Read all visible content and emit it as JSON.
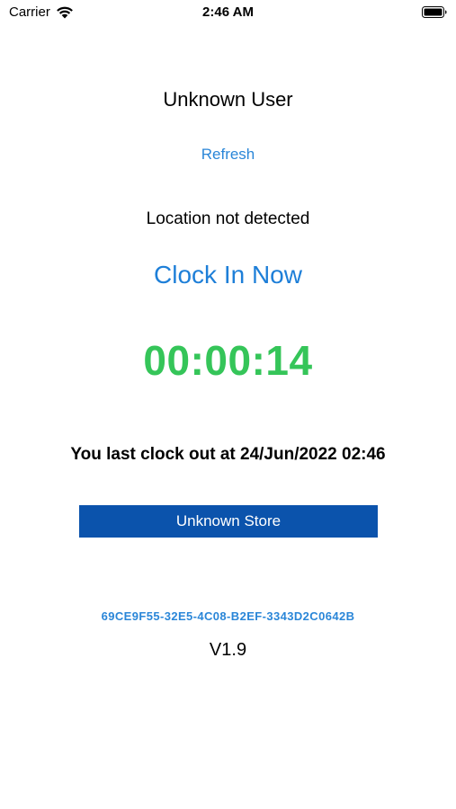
{
  "status_bar": {
    "carrier": "Carrier",
    "time": "2:46 AM",
    "icons": [
      "wifi-icon",
      "battery-icon"
    ]
  },
  "main": {
    "user_name": "Unknown User",
    "refresh_label": "Refresh",
    "location_status": "Location not detected",
    "clock_in_label": "Clock In Now",
    "timer": "00:00:14",
    "last_clock_out": "You last clock out at 24/Jun/2022 02:46",
    "store_button_label": "Unknown Store",
    "device_id": "69CE9F55-32E5-4C08-B2EF-3343D2C0642B",
    "version": "V1.9"
  },
  "colors": {
    "link_blue": "#2a86d8",
    "timer_green": "#35c559",
    "store_button_bg": "#0b53ac",
    "background": "#ffffff"
  }
}
